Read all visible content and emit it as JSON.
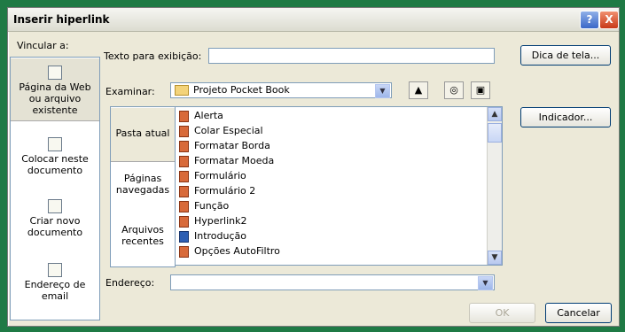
{
  "dialog": {
    "title": "Inserir hiperlink",
    "help_symbol": "?",
    "close_symbol": "X"
  },
  "sidebar": {
    "header": "Vincular a:",
    "items": [
      {
        "label": "Página da Web ou arquivo existente",
        "icon": "globe-page-icon",
        "selected": true
      },
      {
        "label": "Colocar neste documento",
        "icon": "document-bookmark-icon",
        "selected": false
      },
      {
        "label": "Criar novo documento",
        "icon": "new-document-icon",
        "selected": false
      },
      {
        "label": "Endereço de email",
        "icon": "email-icon",
        "selected": false
      }
    ]
  },
  "display_text": {
    "label": "Texto para exibição:",
    "value": ""
  },
  "screen_tip_button": "Dica de tela...",
  "browse": {
    "label": "Examinar:",
    "folder": "Projeto Pocket Book",
    "icons": [
      "up-folder-icon",
      "search-web-icon",
      "browse-file-icon"
    ]
  },
  "bookmark_button": "Indicador...",
  "tabs": [
    {
      "label": "Pasta atual",
      "selected": true
    },
    {
      "label": "Páginas navegadas",
      "selected": false
    },
    {
      "label": "Arquivos recentes",
      "selected": false
    }
  ],
  "files": [
    {
      "name": "Alerta",
      "icon": "file-icon"
    },
    {
      "name": "Colar Especial",
      "icon": "file-icon"
    },
    {
      "name": "Formatar Borda",
      "icon": "file-icon"
    },
    {
      "name": "Formatar Moeda",
      "icon": "file-icon"
    },
    {
      "name": "Formulário",
      "icon": "file-icon"
    },
    {
      "name": "Formulário 2",
      "icon": "file-icon"
    },
    {
      "name": "Função",
      "icon": "file-icon"
    },
    {
      "name": "Hyperlink2",
      "icon": "file-icon"
    },
    {
      "name": "Introdução",
      "icon": "word-doc-icon"
    },
    {
      "name": "Opções AutoFiltro",
      "icon": "file-icon"
    }
  ],
  "address": {
    "label": "Endereço:",
    "value": ""
  },
  "buttons": {
    "ok": "OK",
    "cancel": "Cancelar"
  }
}
